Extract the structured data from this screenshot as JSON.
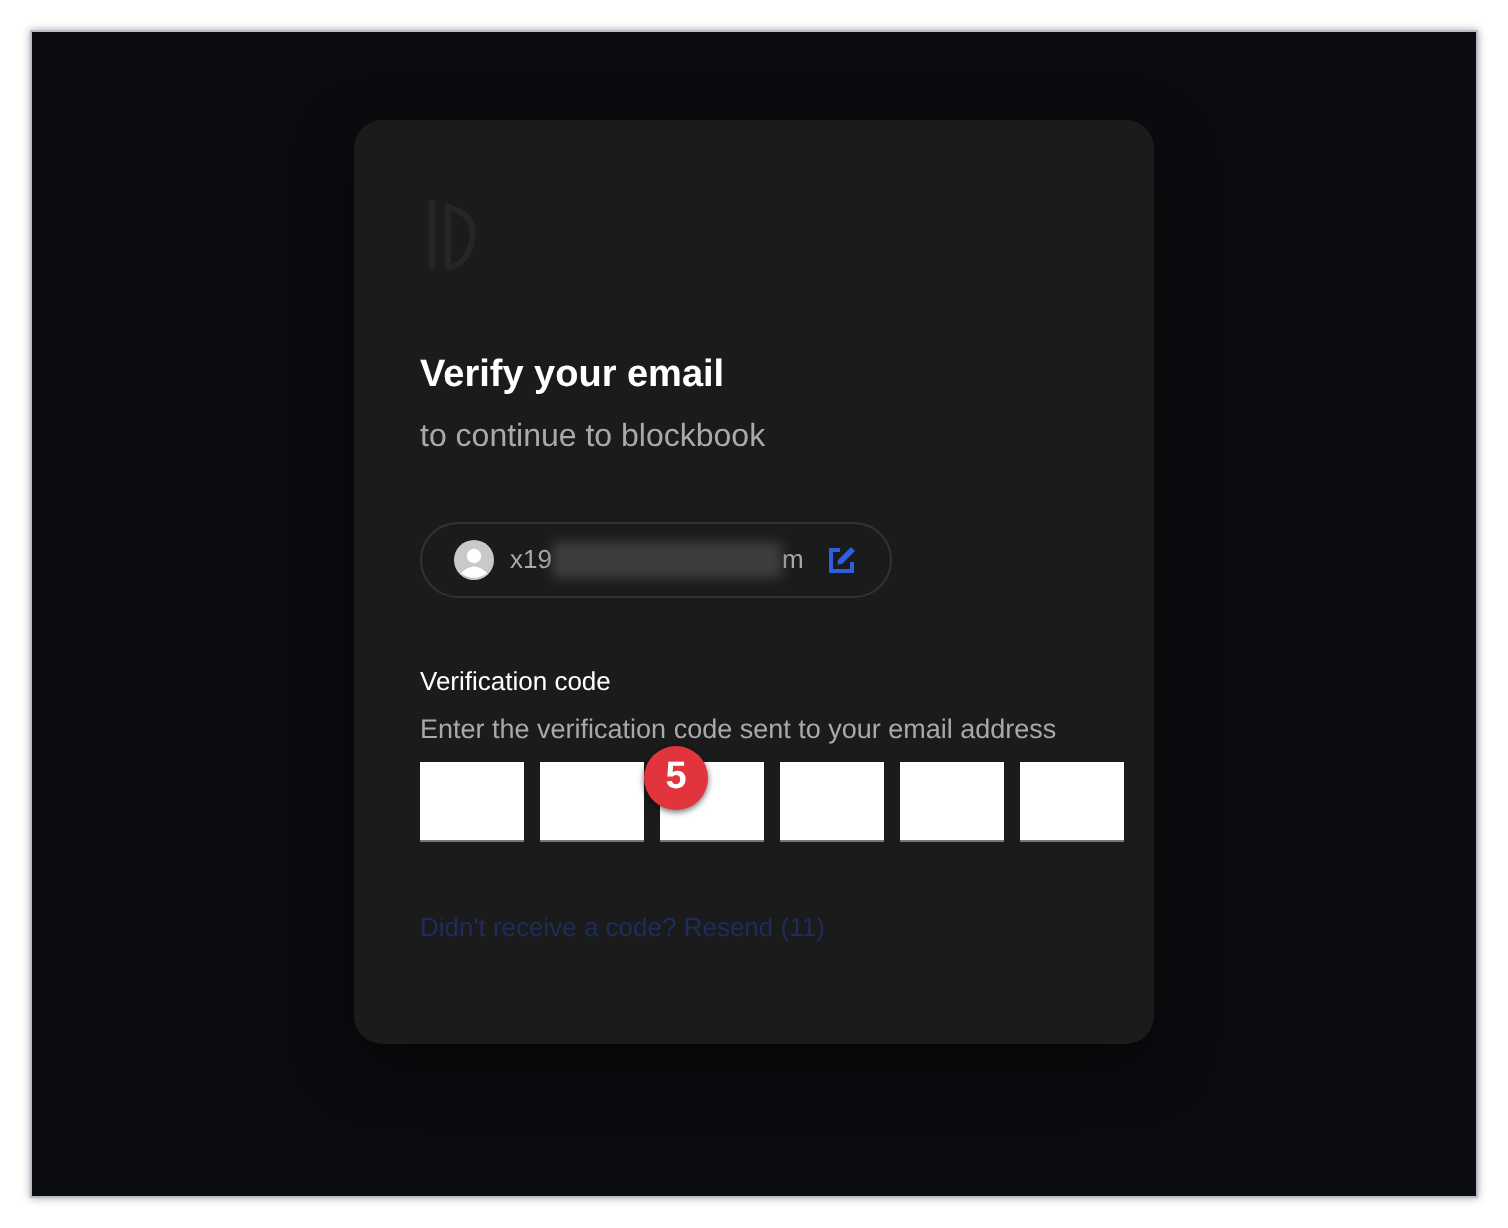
{
  "title": "Verify your email",
  "subtitle": "to continue to blockbook",
  "account": {
    "email_start": "x19",
    "email_end": "m",
    "redacted": true
  },
  "verification": {
    "label": "Verification code",
    "hint": "Enter the verification code sent to your email address",
    "digits": [
      {
        "kind": "box"
      },
      {
        "kind": "box"
      },
      {
        "kind": "box"
      },
      {
        "kind": "box"
      },
      {
        "kind": "box"
      },
      {
        "kind": "box"
      }
    ]
  },
  "step_badge": "5",
  "resend_link": "Didn't receive a code? Resend (11)"
}
